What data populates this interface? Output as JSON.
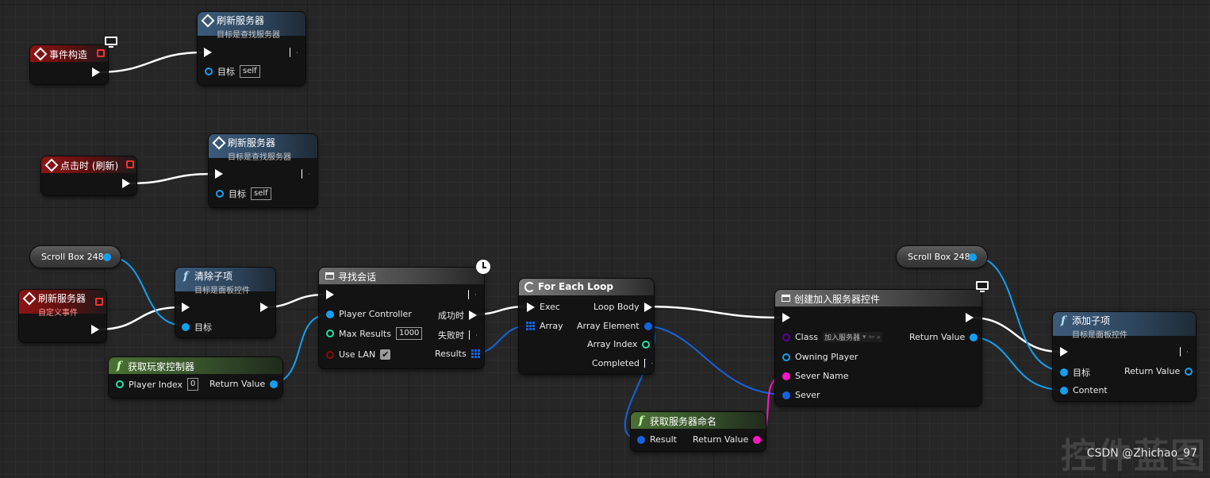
{
  "nodes": {
    "event_construct": {
      "title": "事件构造"
    },
    "refresh1": {
      "title": "刷新服务器",
      "subtitle": "目标是查找服务器",
      "target_label": "目标",
      "target_value": "self"
    },
    "on_clicked": {
      "title": "点击时 (刷新)"
    },
    "refresh2": {
      "title": "刷新服务器",
      "subtitle": "目标是查找服务器",
      "target_label": "目标",
      "target_value": "self"
    },
    "scrollbox_var1": {
      "label": "Scroll Box 248"
    },
    "custom_event": {
      "title": "刷新服务器",
      "subtitle": "自定义事件"
    },
    "clear_children": {
      "title": "清除子项",
      "subtitle": "目标是面板控件",
      "target_label": "目标"
    },
    "get_player_controller": {
      "title": "获取玩家控制器",
      "player_index_label": "Player Index",
      "player_index_value": "0",
      "return_label": "Return Value"
    },
    "find_sessions": {
      "title": "寻找会话",
      "player_controller_label": "Player Controller",
      "max_results_label": "Max Results",
      "max_results_value": "1000",
      "use_lan_label": "Use LAN",
      "use_lan_checked": "✔",
      "success_label": "成功时",
      "failure_label": "失败时",
      "results_label": "Results"
    },
    "for_each": {
      "title": "For Each Loop",
      "exec_label": "Exec",
      "array_label": "Array",
      "loop_body_label": "Loop Body",
      "array_element_label": "Array Element",
      "array_index_label": "Array Index",
      "completed_label": "Completed"
    },
    "get_server_name": {
      "title": "获取服务器命名",
      "result_label": "Result",
      "return_label": "Return Value"
    },
    "create_widget": {
      "title": "创建加入服务器控件",
      "class_label": "Class",
      "class_value": "加入服务器",
      "owning_player_label": "Owning Player",
      "sever_name_label": "Sever Name",
      "sever_label": "Sever",
      "return_label": "Return Value"
    },
    "scrollbox_var2": {
      "label": "Scroll Box 248"
    },
    "add_child": {
      "title": "添加子项",
      "subtitle": "目标是面板控件",
      "target_label": "目标",
      "content_label": "Content",
      "return_label": "Return Value"
    }
  },
  "watermark": "控件蓝图",
  "credit": "CSDN @Zhichao_97",
  "colors": {
    "exec_wire": "#ffffff",
    "object_wire": "#14a0f0",
    "struct_wire": "#1463e0",
    "string_wire": "#ff17c6",
    "int_wire": "#1fe0a8",
    "event_header": "#8e1414",
    "function_header": "#3c5a7a",
    "pure_header": "#4b7035"
  },
  "icons": [
    "diamond-event-icon",
    "function-icon",
    "monitor-icon",
    "clock-icon",
    "loop-icon",
    "array-grid-icon",
    "macro-grid-icon"
  ]
}
